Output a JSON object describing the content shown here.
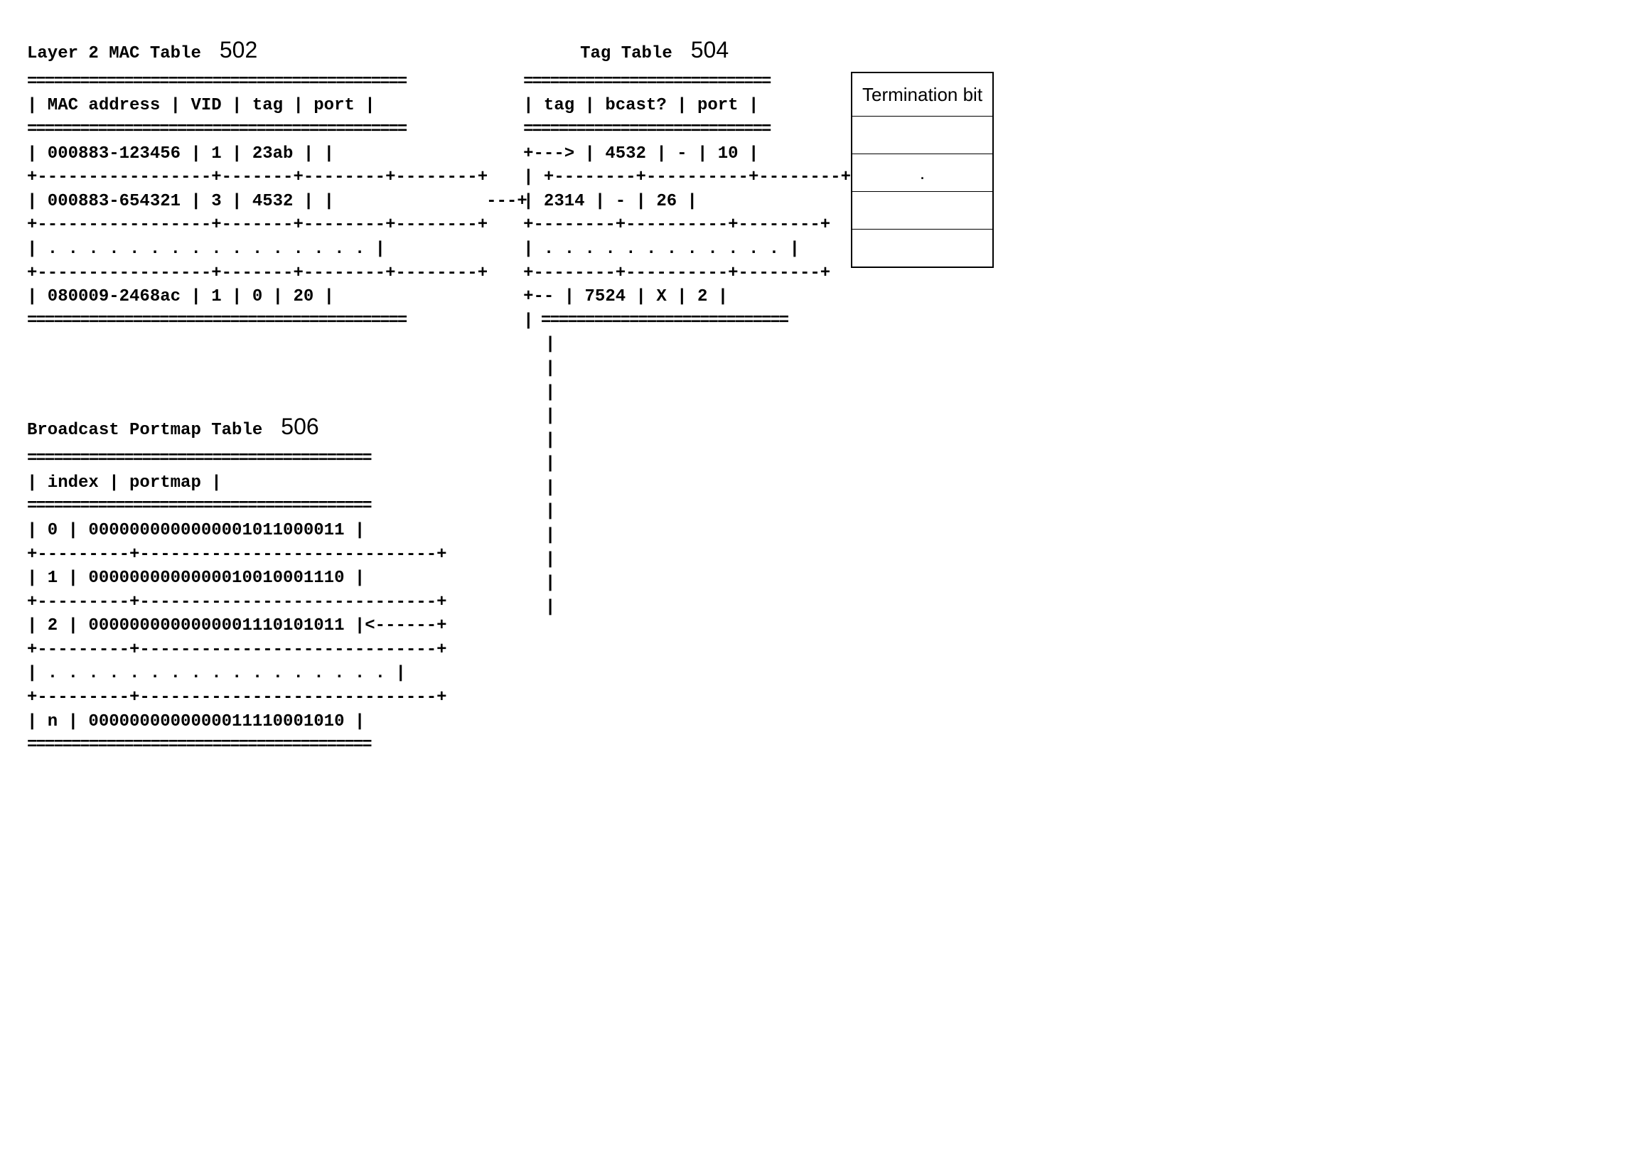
{
  "mac_table": {
    "title": "Layer 2 MAC Table",
    "fig": "502",
    "headers": {
      "c1": "MAC address",
      "c2": "VID",
      "c3": "tag",
      "c4": "port"
    },
    "rows": [
      {
        "c1": "000883-123456",
        "c2": "1",
        "c3": "23ab",
        "c4": ""
      },
      {
        "c1": "000883-654321",
        "c2": "3",
        "c3": "4532",
        "c4": ""
      },
      {
        "c1": ". . . . . . . . .  . . . .  . . .",
        "span": true
      },
      {
        "c1": "080009-2468ac",
        "c2": "1",
        "c3": "0",
        "c4": "20"
      }
    ]
  },
  "tag_table": {
    "title": "Tag Table",
    "fig": "504",
    "headers": {
      "c1": "tag",
      "c2": "bcast?",
      "c3": "port"
    },
    "rows": [
      {
        "c1": "4532",
        "c2": "-",
        "c3": "10"
      },
      {
        "c1": "2314",
        "c2": "-",
        "c3": "26"
      },
      {
        "c1": ". . . . . . . . . . . .",
        "span": true
      },
      {
        "c1": "7524",
        "c2": "X",
        "c3": "2"
      }
    ],
    "term_header": "Termination bit",
    "term_rows": [
      "",
      ".",
      "",
      ""
    ]
  },
  "portmap_table": {
    "title": "Broadcast Portmap Table",
    "fig": "506",
    "headers": {
      "c1": "index",
      "c2": "portmap"
    },
    "rows": [
      {
        "c1": "0",
        "c2": "0000000000000001011000011"
      },
      {
        "c1": "1",
        "c2": "0000000000000010010001110"
      },
      {
        "c1": "2",
        "c2": "0000000000000001110101011"
      },
      {
        "c1": ". . . . . . . . . . . . . . . . .",
        "span": true
      },
      {
        "c1": "n",
        "c2": "0000000000000011110001010"
      }
    ]
  },
  "arrows": {
    "mac_to_tag": "+--->",
    "tag_to_pm_tail": "+--",
    "pm_arrow": "<------+"
  }
}
